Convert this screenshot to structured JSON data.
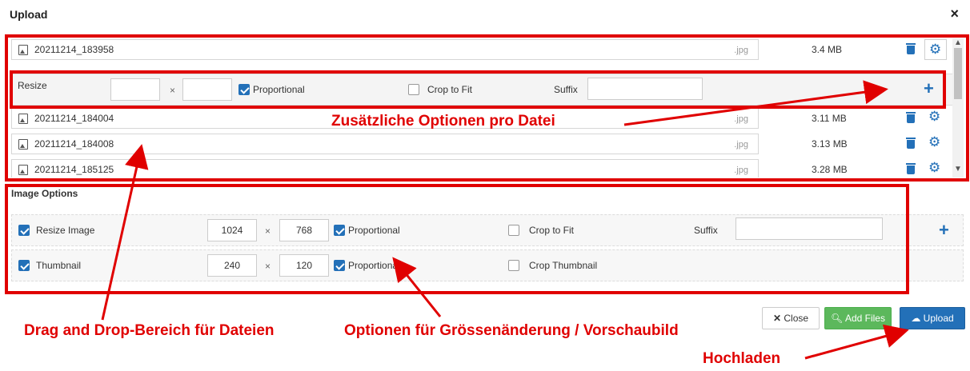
{
  "dialog": {
    "title": "Upload",
    "close_glyph": "×"
  },
  "files": [
    {
      "name": "20211214_183958",
      "ext": ".jpg",
      "size": "3.4 MB",
      "options_open": true
    },
    {
      "name": "20211214_184004",
      "ext": ".jpg",
      "size": "3.11 MB"
    },
    {
      "name": "20211214_184008",
      "ext": ".jpg",
      "size": "3.13 MB"
    },
    {
      "name": "20211214_185125",
      "ext": ".jpg",
      "size": "3.28 MB"
    }
  ],
  "file_resize": {
    "label": "Resize",
    "width": "",
    "height": "",
    "times": "×",
    "proportional_label": "Proportional",
    "proportional_checked": true,
    "crop_label": "Crop to Fit",
    "crop_checked": false,
    "suffix_label": "Suffix",
    "suffix_value": ""
  },
  "image_options": {
    "title": "Image Options",
    "resize": {
      "label": "Resize Image",
      "checked": true,
      "width": "1024",
      "height": "768",
      "times": "×",
      "proportional_label": "Proportional",
      "proportional_checked": true,
      "crop_label": "Crop to Fit",
      "crop_checked": false,
      "suffix_label": "Suffix",
      "suffix_value": ""
    },
    "thumbnail": {
      "label": "Thumbnail",
      "checked": true,
      "width": "240",
      "height": "120",
      "times": "×",
      "proportional_label": "Proportional",
      "proportional_checked": true,
      "crop_label": "Crop Thumbnail",
      "crop_checked": false
    }
  },
  "buttons": {
    "close": "Close",
    "add_files": "Add Files",
    "upload": "Upload"
  },
  "annotations": {
    "per_file_options": "Zusätzliche Optionen pro Datei",
    "drag_drop": "Drag and Drop-Bereich für Dateien",
    "resize_thumbnail": "Optionen für Grössenänderung / Vorschaubild",
    "upload": "Hochladen"
  },
  "colors": {
    "accent": "#2370b8",
    "success": "#5cb85c",
    "annotation": "#e00000"
  },
  "icons": [
    "image-file-icon",
    "trash-icon",
    "gear-icon",
    "plus-icon",
    "close-icon",
    "search-icon",
    "cloud-upload-icon"
  ]
}
